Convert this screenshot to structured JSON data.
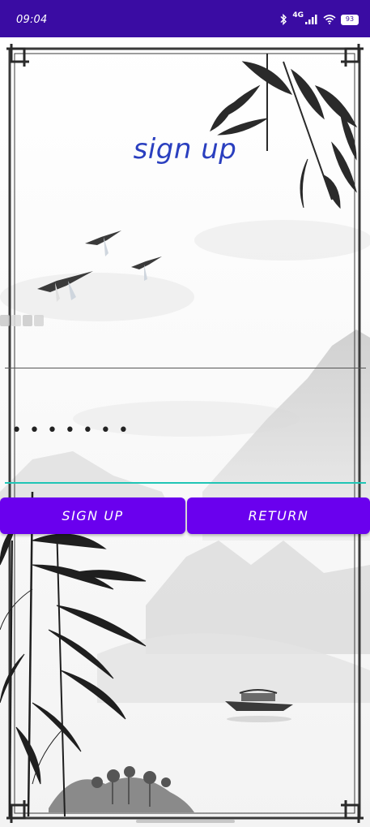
{
  "status_bar": {
    "time": "09:04",
    "network": "4G",
    "battery": "93",
    "icons": [
      "bluetooth-icon",
      "signal-icon",
      "wifi-icon",
      "battery-icon"
    ]
  },
  "form": {
    "title": "sign up",
    "password_mask": "•••••••"
  },
  "buttons": {
    "signup_label": "SIGN UP",
    "return_label": "RETURN"
  },
  "colors": {
    "status_bar": "#3a0ca3",
    "title": "#2a3fbf",
    "button": "#6a00ee",
    "focus_underline": "#20c5b5"
  }
}
